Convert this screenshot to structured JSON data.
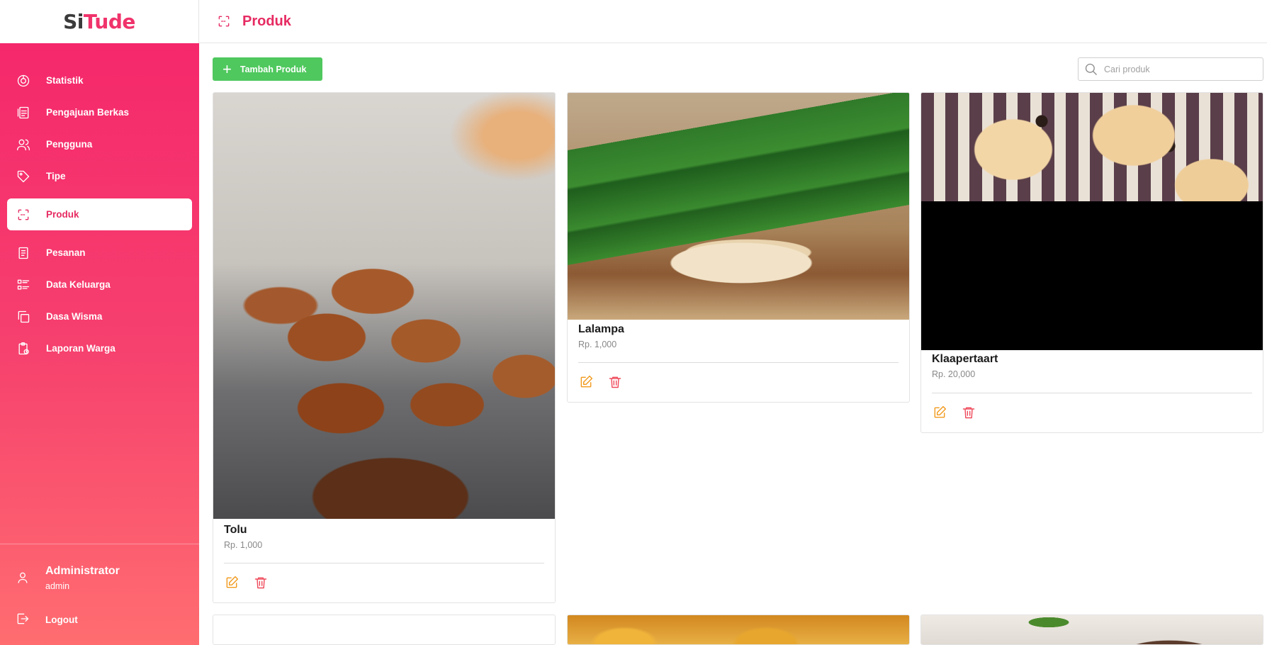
{
  "app": {
    "logo_part1": "Si",
    "logo_part2": "Tude"
  },
  "header": {
    "title": "Produk",
    "icon": "scan-icon"
  },
  "sidebar": {
    "items": [
      {
        "label": "Statistik",
        "icon": "chart-pie-icon"
      },
      {
        "label": "Pengajuan Berkas",
        "icon": "document-icon"
      },
      {
        "label": "Pengguna",
        "icon": "users-icon"
      },
      {
        "label": "Tipe",
        "icon": "tag-icon"
      },
      {
        "label": "Produk",
        "icon": "scan-icon",
        "active": true
      },
      {
        "label": "Pesanan",
        "icon": "receipt-icon"
      },
      {
        "label": "Data Keluarga",
        "icon": "list-icon"
      },
      {
        "label": "Dasa Wisma",
        "icon": "copy-icon"
      },
      {
        "label": "Laporan Warga",
        "icon": "clipboard-icon"
      }
    ],
    "user": {
      "name": "Administrator",
      "role": "admin"
    },
    "logout_label": "Logout"
  },
  "toolbar": {
    "add_label": "Tambah Produk",
    "search_placeholder": "Cari produk"
  },
  "products": [
    {
      "name": "Tolu",
      "price": "Rp. 1,000"
    },
    {
      "name": "Lalampa",
      "price": "Rp. 1,000"
    },
    {
      "name": "Klaapertaart",
      "price": "Rp. 20,000"
    }
  ],
  "colors": {
    "accent": "#e62b62",
    "sidebar_top": "#f5286c",
    "sidebar_bottom": "#ff6d70",
    "add_button": "#4fc85e",
    "edit_icon": "#f19a1d",
    "delete_icon": "#ef4a5b"
  }
}
